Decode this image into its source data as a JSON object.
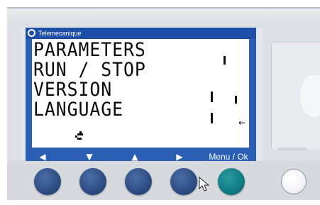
{
  "device": {
    "brand": "Telemecanique"
  },
  "menu": {
    "items": [
      "PARAMETERS",
      "RUN / STOP",
      "VERSION",
      "LANGUAGE"
    ]
  },
  "nav": {
    "left_icon": "arrow-left-icon",
    "down_icon": "arrow-down-icon",
    "up_icon": "arrow-up-icon",
    "right_icon": "arrow-right-icon",
    "left_glyph": "◀",
    "down_glyph": "▼",
    "up_glyph": "▲",
    "right_glyph": "▶",
    "menu_label": "Menu / Ok"
  },
  "colors": {
    "lcd_blue": "#2b5fb3",
    "title_blue": "#1e4fa8",
    "button_blue": "#2f4f86",
    "button_teal": "#0f7b82",
    "button_white": "#f3f4f6"
  }
}
